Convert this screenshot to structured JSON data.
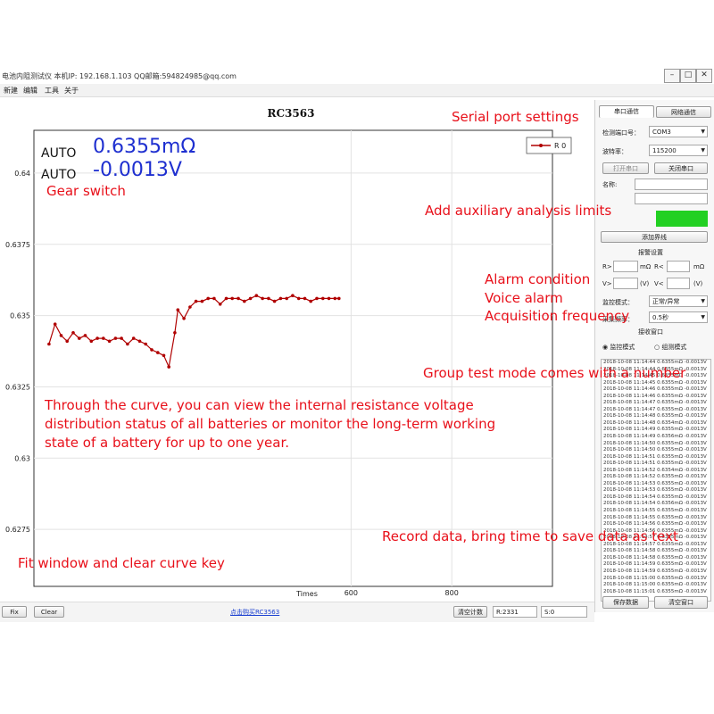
{
  "window": {
    "title": "电池内阻测试仪  本机IP: 192.168.1.103  QQ邮箱:594824985@qq.com",
    "controls": [
      "–",
      "□",
      "✕"
    ]
  },
  "menu": [
    "新建",
    "编辑",
    "工具",
    "关于"
  ],
  "chart": {
    "title": "RC3563",
    "legend": "R 0",
    "xlabel": "Times"
  },
  "chart_data": {
    "type": "line",
    "title": "RC3563",
    "xlabel": "Times",
    "ylabel": "",
    "xlim": [
      -30,
      1000
    ],
    "ylim": [
      0.6255,
      0.6415
    ],
    "yticks": [
      0.6275,
      0.63,
      0.6325,
      0.635,
      0.6375,
      0.64
    ],
    "ytick_labels": [
      "0.6275",
      "0.63",
      "0.6325",
      "0.635",
      "0.6375",
      "0.64"
    ],
    "xticks": [
      600,
      800
    ],
    "xtick_labels": [
      "600",
      "800"
    ],
    "grid": true,
    "legend_position": "top-right",
    "series": [
      {
        "name": "R 0",
        "color": "#b00000",
        "points": [
          [
            0,
            0.634
          ],
          [
            12,
            0.6347
          ],
          [
            24,
            0.6343
          ],
          [
            36,
            0.6341
          ],
          [
            48,
            0.6344
          ],
          [
            60,
            0.6342
          ],
          [
            72,
            0.6343
          ],
          [
            84,
            0.6341
          ],
          [
            96,
            0.6342
          ],
          [
            108,
            0.6342
          ],
          [
            120,
            0.6341
          ],
          [
            132,
            0.6342
          ],
          [
            144,
            0.6342
          ],
          [
            156,
            0.634
          ],
          [
            168,
            0.6342
          ],
          [
            180,
            0.6341
          ],
          [
            192,
            0.634
          ],
          [
            204,
            0.6338
          ],
          [
            216,
            0.6337
          ],
          [
            228,
            0.6336
          ],
          [
            238,
            0.6332
          ],
          [
            250,
            0.6344
          ],
          [
            256,
            0.6352
          ],
          [
            268,
            0.6349
          ],
          [
            280,
            0.6353
          ],
          [
            292,
            0.6355
          ],
          [
            304,
            0.6355
          ],
          [
            316,
            0.6356
          ],
          [
            328,
            0.6356
          ],
          [
            340,
            0.6354
          ],
          [
            352,
            0.6356
          ],
          [
            364,
            0.6356
          ],
          [
            376,
            0.6356
          ],
          [
            388,
            0.6355
          ],
          [
            400,
            0.6356
          ],
          [
            412,
            0.6357
          ],
          [
            424,
            0.6356
          ],
          [
            436,
            0.6356
          ],
          [
            448,
            0.6355
          ],
          [
            460,
            0.6356
          ],
          [
            472,
            0.6356
          ],
          [
            484,
            0.6357
          ],
          [
            496,
            0.6356
          ],
          [
            508,
            0.6356
          ],
          [
            520,
            0.6355
          ],
          [
            532,
            0.6356
          ],
          [
            544,
            0.6356
          ],
          [
            556,
            0.6356
          ],
          [
            568,
            0.6356
          ],
          [
            576,
            0.6356
          ]
        ]
      }
    ]
  },
  "readings": {
    "mode1": "AUTO",
    "value1": "0.6355mΩ",
    "mode2": "AUTO",
    "value2": "-0.0013V"
  },
  "annotations": {
    "gear": "Gear switch",
    "serial": "Serial port settings",
    "aux": "Add auxiliary analysis limits",
    "alarm": "Alarm condition",
    "voice": "Voice alarm",
    "freq": "Acquisition frequency",
    "group": "Group test mode comes with a number",
    "curve_line1": "Through the curve, you can view the internal resistance voltage",
    "curve_line2": "distribution status of all batteries or monitor the long-term working",
    "curve_line3": "state of a battery for up to one year.",
    "record": "Record data, bring time to save data as text",
    "fit": "Fit window and clear curve key"
  },
  "panel": {
    "tab_serial": "串口通信",
    "tab_network": "网络通信",
    "port_label": "检测端口号：",
    "port_value": "COM3",
    "baud_label": "波特率：",
    "baud_value": "115200",
    "open_btn": "打开串口",
    "close_btn": "关闭串口",
    "name_label": "名称:",
    "add_limit_btn": "添加界线",
    "alarm_settings": "报警设置",
    "r_gt": "R>",
    "r_unit1": "mΩ",
    "r_lt": "R<",
    "r_unit2": "mΩ",
    "v_gt": "V>",
    "v_unit1": "(V)",
    "v_lt": "V<",
    "v_unit2": "(V)",
    "monitor_label": "监控模式：",
    "monitor_value": "正常/异常",
    "interval_label": "采集频率：",
    "interval_value": "0.5秒",
    "receive_label": "接收窗口",
    "radio_monitor": "监控模式",
    "radio_group": "组测模式",
    "save_btn": "保存数据",
    "clear_btn": "清空窗口"
  },
  "log": [
    "2018-10-08 11:14:44  0.6355mΩ  -0.0013V",
    "2018-10-08 11:14:44  0.6355mΩ  -0.0013V",
    "2018-10-08 11:14:45  0.6355mΩ  -0.0013V",
    "2018-10-08 11:14:45  0.6355mΩ  -0.0013V",
    "2018-10-08 11:14:46  0.6355mΩ  -0.0013V",
    "2018-10-08 11:14:46  0.6355mΩ  -0.0013V",
    "2018-10-08 11:14:47  0.6355mΩ  -0.0013V",
    "2018-10-08 11:14:47  0.6355mΩ  -0.0013V",
    "2018-10-08 11:14:48  0.6355mΩ  -0.0013V",
    "2018-10-08 11:14:48  0.6354mΩ  -0.0013V",
    "2018-10-08 11:14:49  0.6355mΩ  -0.0013V",
    "2018-10-08 11:14:49  0.6356mΩ  -0.0013V",
    "2018-10-08 11:14:50  0.6355mΩ  -0.0013V",
    "2018-10-08 11:14:50  0.6355mΩ  -0.0013V",
    "2018-10-08 11:14:51  0.6355mΩ  -0.0013V",
    "2018-10-08 11:14:51  0.6355mΩ  -0.0013V",
    "2018-10-08 11:14:52  0.6354mΩ  -0.0013V",
    "2018-10-08 11:14:52  0.6355mΩ  -0.0013V",
    "2018-10-08 11:14:53  0.6355mΩ  -0.0013V",
    "2018-10-08 11:14:53  0.6355mΩ  -0.0013V",
    "2018-10-08 11:14:54  0.6355mΩ  -0.0013V",
    "2018-10-08 11:14:54  0.6356mΩ  -0.0013V",
    "2018-10-08 11:14:55  0.6355mΩ  -0.0013V",
    "2018-10-08 11:14:55  0.6355mΩ  -0.0013V",
    "2018-10-08 11:14:56  0.6355mΩ  -0.0013V",
    "2018-10-08 11:14:56  0.6355mΩ  -0.0013V",
    "2018-10-08 11:14:57  0.6355mΩ  -0.0013V",
    "2018-10-08 11:14:57  0.6355mΩ  -0.0013V",
    "2018-10-08 11:14:58  0.6355mΩ  -0.0013V",
    "2018-10-08 11:14:58  0.6355mΩ  -0.0013V",
    "2018-10-08 11:14:59  0.6355mΩ  -0.0013V",
    "2018-10-08 11:14:59  0.6355mΩ  -0.0013V",
    "2018-10-08 11:15:00  0.6355mΩ  -0.0013V",
    "2018-10-08 11:15:00  0.6355mΩ  -0.0013V",
    "2018-10-08 11:15:01  0.6355mΩ  -0.0013V"
  ],
  "bottom": {
    "fix": "Fix",
    "clear": "Clear",
    "link": "点击购买RC3563",
    "clear_count": "清空计数",
    "r_count": "R:2331",
    "s_count": "S:0"
  },
  "colors": {
    "annotation": "#e8101a",
    "reading": "#1e2fd0",
    "series": "#b00000",
    "limit_bar": "#22d022"
  }
}
